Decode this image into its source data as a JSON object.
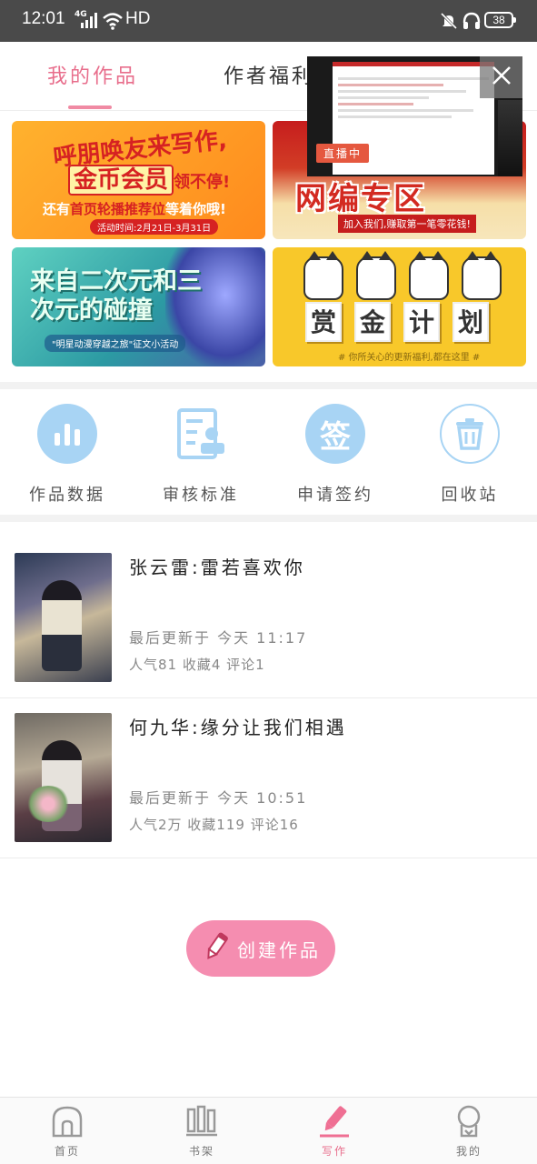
{
  "status_bar": {
    "time": "12:01",
    "network": "4G",
    "hd": "HD",
    "battery": "38"
  },
  "tabs": [
    {
      "label": "我的作品",
      "active": true
    },
    {
      "label": "作者福利",
      "active": false
    }
  ],
  "banners": [
    {
      "line1": "呼朋唤友来写作,",
      "line2_a": "金币会员",
      "line2_b": "领不停!",
      "line3_a": "还有",
      "line3_hl": "首页轮播推荐位",
      "line3_b": "等着你哦!",
      "line4": "活动时间:2月21日-3月31日"
    },
    {
      "title": "网编专区",
      "subtitle": "加入我们,赚取第一笔零花钱!"
    },
    {
      "title": "来自二次元和三次元的碰撞",
      "subtitle": "\"明星动漫穿越之旅\"征文小活动"
    },
    {
      "title_chars": [
        "赏",
        "金",
        "计",
        "划"
      ],
      "subtitle": "# 你所关心的更新福利,都在这里 #"
    }
  ],
  "actions": [
    {
      "label": "作品数据",
      "icon": "bar-chart-icon"
    },
    {
      "label": "审核标准",
      "icon": "document-stamp-icon"
    },
    {
      "label": "申请签约",
      "icon": "sign-icon",
      "glyph": "签"
    },
    {
      "label": "回收站",
      "icon": "trash-icon"
    }
  ],
  "works": [
    {
      "title": "张云雷:雷若喜欢你",
      "updated": "最后更新于 今天 11:17",
      "stats": "人气81  收藏4  评论1"
    },
    {
      "title": "何九华:缘分让我们相遇",
      "updated": "最后更新于 今天 10:51",
      "stats": "人气2万  收藏119  评论16"
    }
  ],
  "create_button": {
    "label": "创建作品"
  },
  "floating_video": {
    "badge": "直播中"
  },
  "bottom_nav": [
    {
      "label": "首页",
      "icon": "home-icon",
      "active": false
    },
    {
      "label": "书架",
      "icon": "bookshelf-icon",
      "active": false
    },
    {
      "label": "写作",
      "icon": "pencil-icon",
      "active": true
    },
    {
      "label": "我的",
      "icon": "profile-icon",
      "active": false
    }
  ],
  "colors": {
    "accent_pink": "#e86e8c",
    "icon_blue": "#a8d4f4",
    "create_button": "#f58db0"
  }
}
